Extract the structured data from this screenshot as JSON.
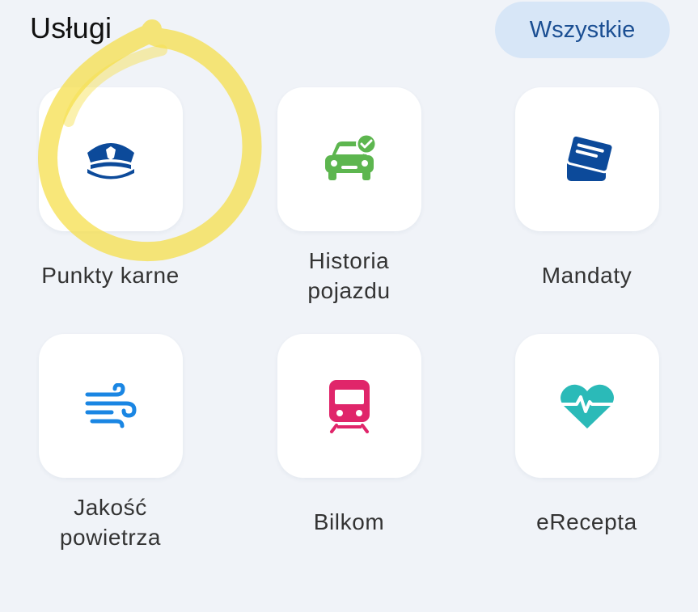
{
  "header": {
    "title": "Usługi",
    "see_all_label": "Wszystkie"
  },
  "services": [
    {
      "label": "Punkty karne",
      "icon": "police-cap-icon",
      "color": "#0c4a9a"
    },
    {
      "label": "Historia pojazdu",
      "icon": "car-check-icon",
      "color": "#5db64f"
    },
    {
      "label": "Mandaty",
      "icon": "ticket-cards-icon",
      "color": "#0c4a9a"
    },
    {
      "label": "Jakość powietrza",
      "icon": "wind-icon",
      "color": "#1a86e3"
    },
    {
      "label": "Bilkom",
      "icon": "train-icon",
      "color": "#e0256a"
    },
    {
      "label": "eRecepta",
      "icon": "heart-pulse-icon",
      "color": "#2bbab8"
    }
  ],
  "colors": {
    "background": "#f0f3f8",
    "accent": "#1b4f93",
    "highlight": "#f6df4c"
  }
}
